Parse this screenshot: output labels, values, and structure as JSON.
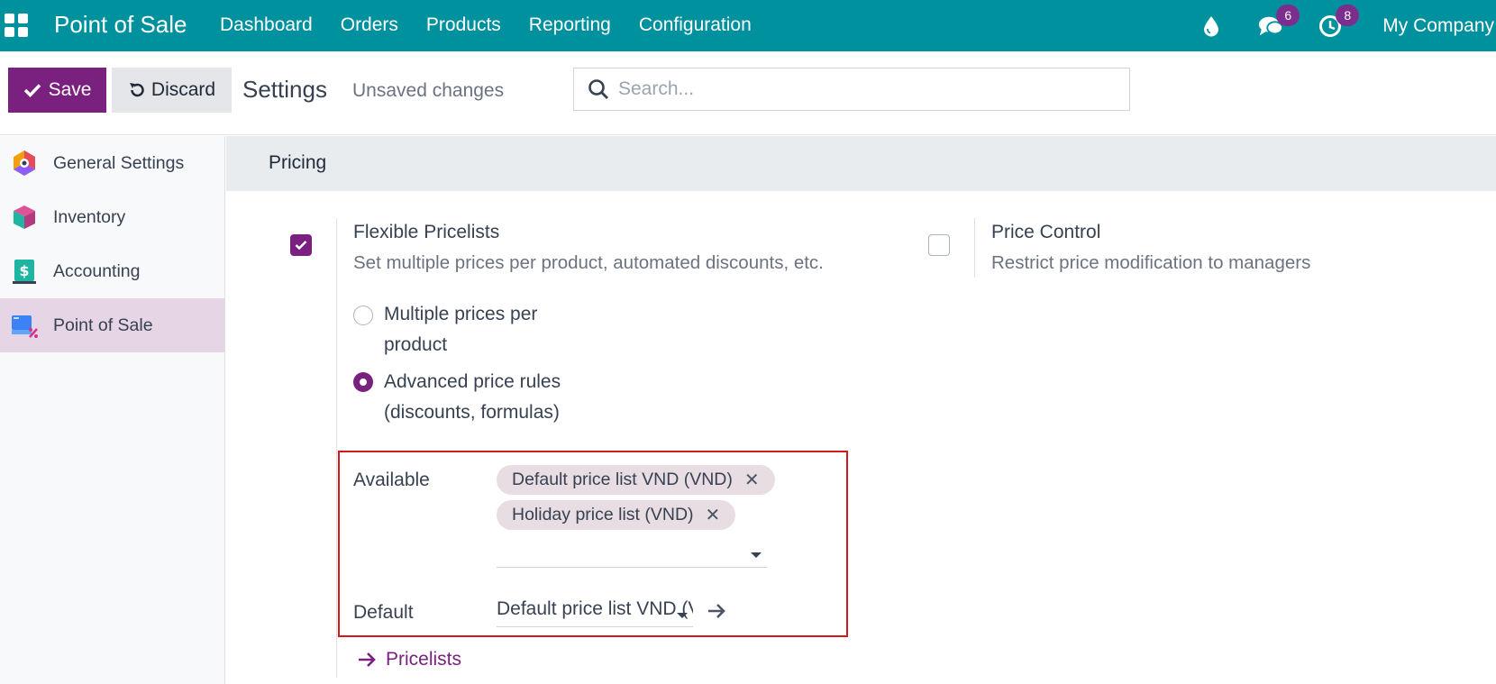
{
  "navbar": {
    "app_title": "Point of Sale",
    "menu": [
      "Dashboard",
      "Orders",
      "Products",
      "Reporting",
      "Configuration"
    ],
    "messages_count": "6",
    "activities_count": "8",
    "company": "My Company"
  },
  "control": {
    "save_label": "Save",
    "discard_label": "Discard",
    "title": "Settings",
    "status": "Unsaved changes",
    "search_placeholder": "Search..."
  },
  "sidebar": {
    "items": [
      {
        "label": "General Settings",
        "icon": "general-settings-icon",
        "active": false
      },
      {
        "label": "Inventory",
        "icon": "inventory-icon",
        "active": false
      },
      {
        "label": "Accounting",
        "icon": "accounting-icon",
        "active": false
      },
      {
        "label": "Point of Sale",
        "icon": "point-of-sale-icon",
        "active": true
      }
    ]
  },
  "section": {
    "title": "Pricing"
  },
  "flexible_pricelists": {
    "title": "Flexible Pricelists",
    "description": "Set multiple prices per product, automated discounts, etc.",
    "checked": true,
    "options": [
      {
        "line1": "Multiple prices per",
        "line2": "product",
        "selected": false
      },
      {
        "line1": "Advanced price rules",
        "line2": "(discounts, formulas)",
        "selected": true
      }
    ],
    "available_label": "Available",
    "available_tags": [
      "Default price list VND (VND)",
      "Holiday price list (VND)"
    ],
    "default_label": "Default",
    "default_value": "Default price list VND (VND)",
    "link_label": "Pricelists"
  },
  "price_control": {
    "title": "Price Control",
    "description": "Restrict price modification to managers",
    "checked": false
  },
  "colors": {
    "navbar": "#00919e",
    "primary": "#7a2180",
    "highlight": "#d11a20"
  }
}
